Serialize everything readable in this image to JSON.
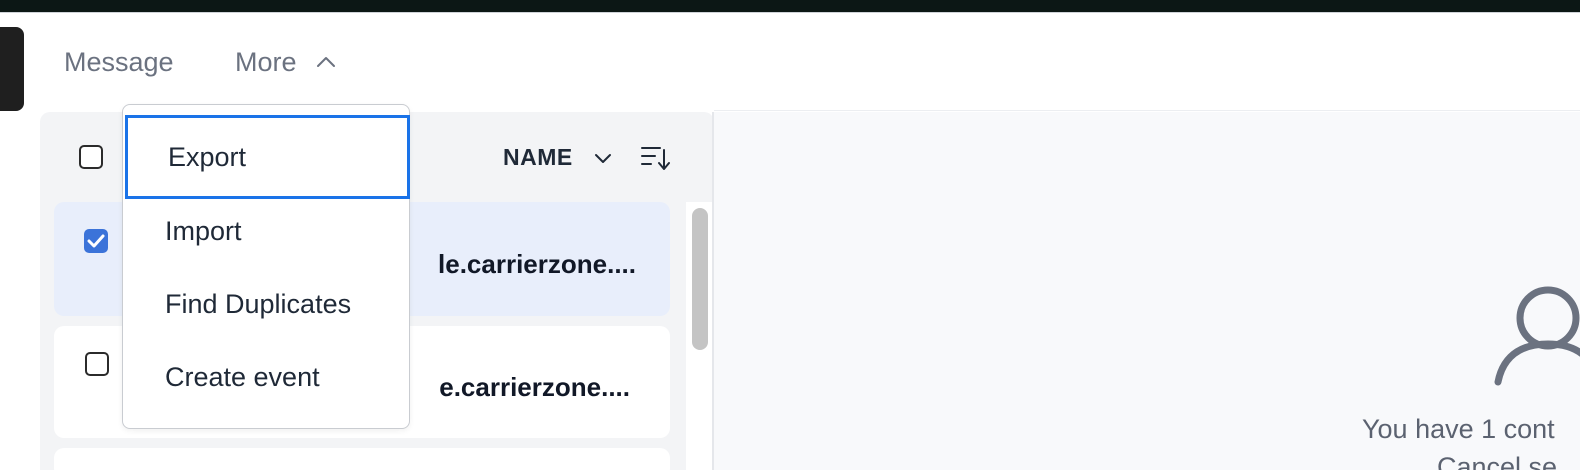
{
  "toolbar": {
    "message_label": "Message",
    "more_label": "More"
  },
  "dropdown": {
    "items": [
      {
        "label": "Export"
      },
      {
        "label": "Import"
      },
      {
        "label": "Find Duplicates"
      },
      {
        "label": "Create event"
      }
    ]
  },
  "list": {
    "sort_label": "NAME",
    "rows": [
      {
        "text": "le.carrierzone....",
        "checked": true
      },
      {
        "text": "e.carrierzone....",
        "checked": false
      }
    ]
  },
  "detail": {
    "empty_text": "You have 1 cont",
    "empty_link": "Cancel se"
  },
  "colors": {
    "accent": "#3b73d9",
    "focus_ring": "#1a73e8",
    "selected_row": "#e8eefb"
  }
}
